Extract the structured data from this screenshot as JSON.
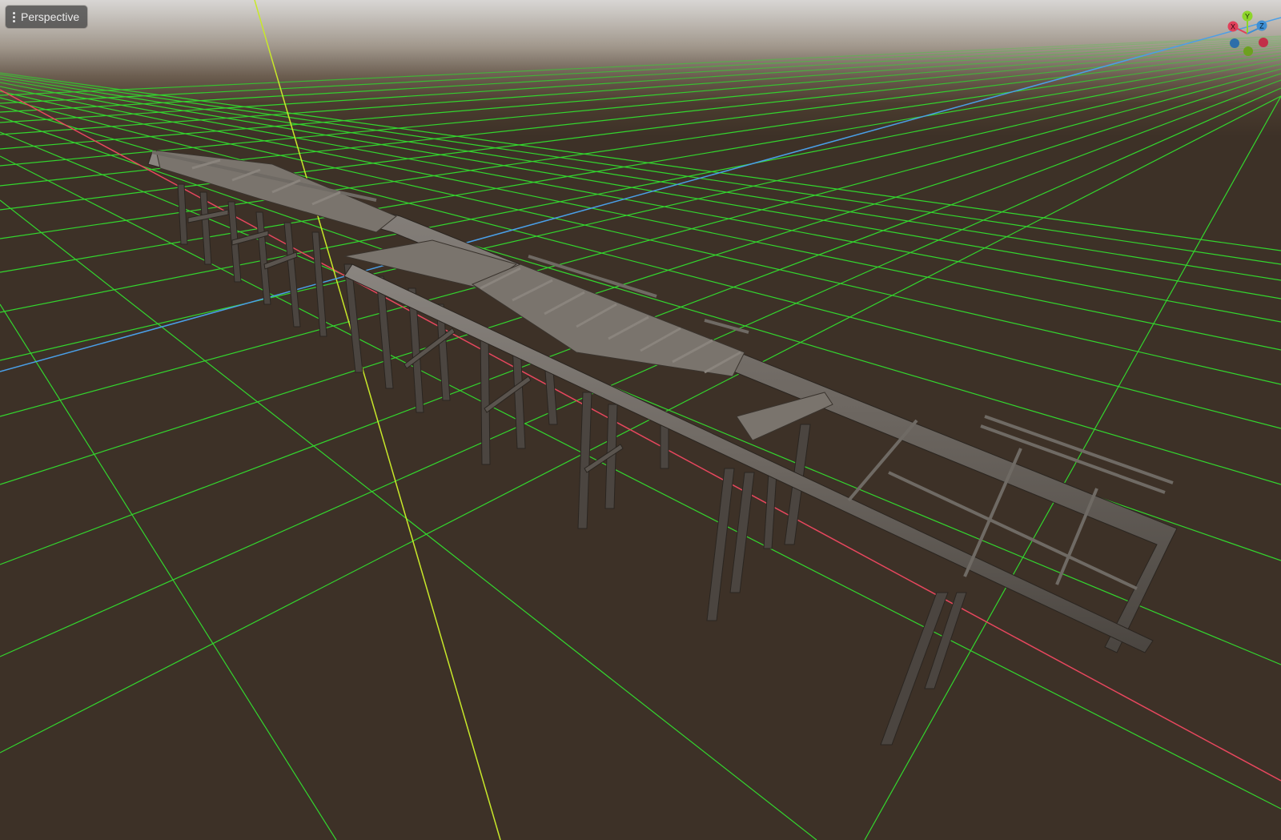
{
  "viewport": {
    "view_menu_label": "Perspective",
    "view_menu_icon": "kebab-menu-icon"
  },
  "gizmo": {
    "x_label": "X",
    "y_label": "Y",
    "z_label": "Z",
    "colors": {
      "x": "#e0405a",
      "y": "#8ed52a",
      "z": "#3f8fd4"
    }
  },
  "grid": {
    "line_color": "#33d62e",
    "floor_color": "#3d3127",
    "axis_x_color": "#e8475e",
    "axis_y_color": "#c8e82a",
    "axis_z_color": "#4a9fe8"
  }
}
